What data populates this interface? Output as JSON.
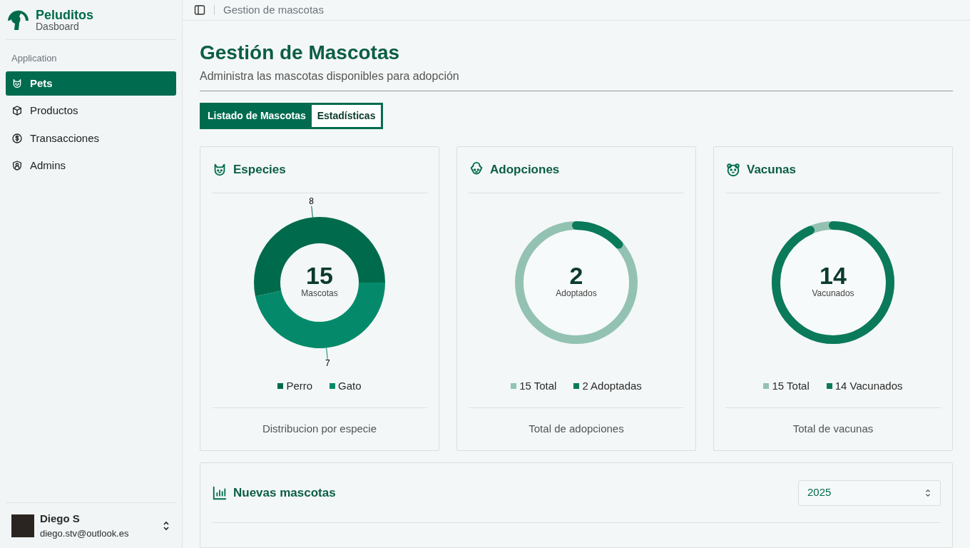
{
  "brand": {
    "title": "Peluditos",
    "subtitle": "Dasboard"
  },
  "sidebar": {
    "section": "Application",
    "items": [
      {
        "label": "Pets",
        "selected": true
      },
      {
        "label": "Productos",
        "selected": false
      },
      {
        "label": "Transacciones",
        "selected": false
      },
      {
        "label": "Admins",
        "selected": false
      }
    ]
  },
  "user": {
    "name": "Diego S",
    "email": "diego.stv@outlook.es"
  },
  "breadcrumb": "Gestion de mascotas",
  "page": {
    "title": "Gestión de Mascotas",
    "subtitle": "Administra las mascotas disponibles para adopción"
  },
  "tabs": [
    {
      "label": "Listado de Mascotas",
      "selected": false
    },
    {
      "label": "Estadísticas",
      "selected": true
    }
  ],
  "cards": [
    {
      "kind": "donut",
      "title": "Especies",
      "center_value": "15",
      "footer": "Distribucion por especie",
      "legend": [
        {
          "color": "#006b4c"
        },
        {
          "color": "#048a6a"
        }
      ],
      "chart_data": {
        "type": "donut",
        "categories": [
          "Perro",
          "Gato"
        ],
        "series": [
          {
            "name": "Mascotas",
            "values": [
              8,
              7
            ]
          }
        ],
        "data_labels": true
      }
    },
    {
      "kind": "gauge",
      "title": "Adopciones",
      "center_value": "2",
      "center_label": "Adoptados",
      "level": 0.133,
      "footer": "Total de adopciones",
      "legend": [
        {
          "label": "15 Total",
          "color": "#93c2b2"
        },
        {
          "label": "2 Adoptadas",
          "color": "#0a7a5a"
        }
      ]
    },
    {
      "kind": "gauge",
      "title": "Vacunas",
      "center_value": "14",
      "center_label": "Vacunados",
      "level": 0.933,
      "footer": "Total de vacunas",
      "legend": [
        {
          "label": "15 Total",
          "color": "#93c2b2"
        },
        {
          "label": "14 Vacunados",
          "color": "#0a7a5a"
        }
      ]
    }
  ],
  "new_pets": {
    "title": "Nuevas mascotas",
    "year": "2025"
  }
}
